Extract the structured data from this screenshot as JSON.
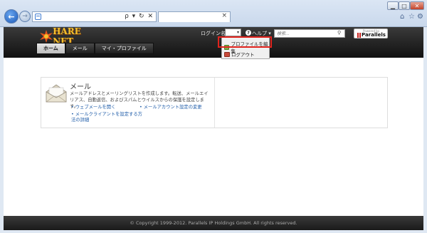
{
  "browser": {
    "address_value": "",
    "tab_close": "×",
    "address_tools": "ρ ▾ ↻ ✕",
    "back_glyph": "←",
    "forward_glyph": "→",
    "window_controls": {
      "minimize": "▁",
      "maximize": "□",
      "close": "✕"
    },
    "right_icons": {
      "home": "⌂",
      "favorites": "☆",
      "tools": "⚙"
    }
  },
  "header": {
    "logo_text": "HARE NET",
    "login_label": "ログイン名:",
    "login_select_value": "",
    "help_link": "ヘルプ ▾",
    "help_icon_glyph": "?",
    "search_placeholder": "検索...",
    "search_icon_glyph": "⚲",
    "powered_by": "Powered by",
    "parallels": "Parallels"
  },
  "nav": {
    "tabs": [
      {
        "label": "ホーム",
        "active": true
      },
      {
        "label": "メール",
        "active": false
      },
      {
        "label": "マイ・プロファイル",
        "active": false
      }
    ]
  },
  "dropdown": {
    "items": [
      {
        "label": "プロファイルを編集"
      },
      {
        "label": "ログアウト"
      }
    ]
  },
  "mail": {
    "title": "メール",
    "description": "メールアドレスとメーリングリストを作成します。転送、メールエイリアス、自動返信、およびスパムとウイルスからの保護を設定します。",
    "links": {
      "webmail": "ウェブメールを開く",
      "account_settings": "メールアカウント設定の変更",
      "client_config": "メールクライアントを設定する方法の詳細"
    },
    "bullet": "•"
  },
  "footer": {
    "copyright": "© Copyright 1999-2012. Parallels IP Holdings GmbH. All rights reserved."
  },
  "colors": {
    "header_bg": "#1f1f1f",
    "logo_gold": "#f5c12d",
    "highlight_red": "#e0231d",
    "link_blue": "#1d5ba8"
  }
}
